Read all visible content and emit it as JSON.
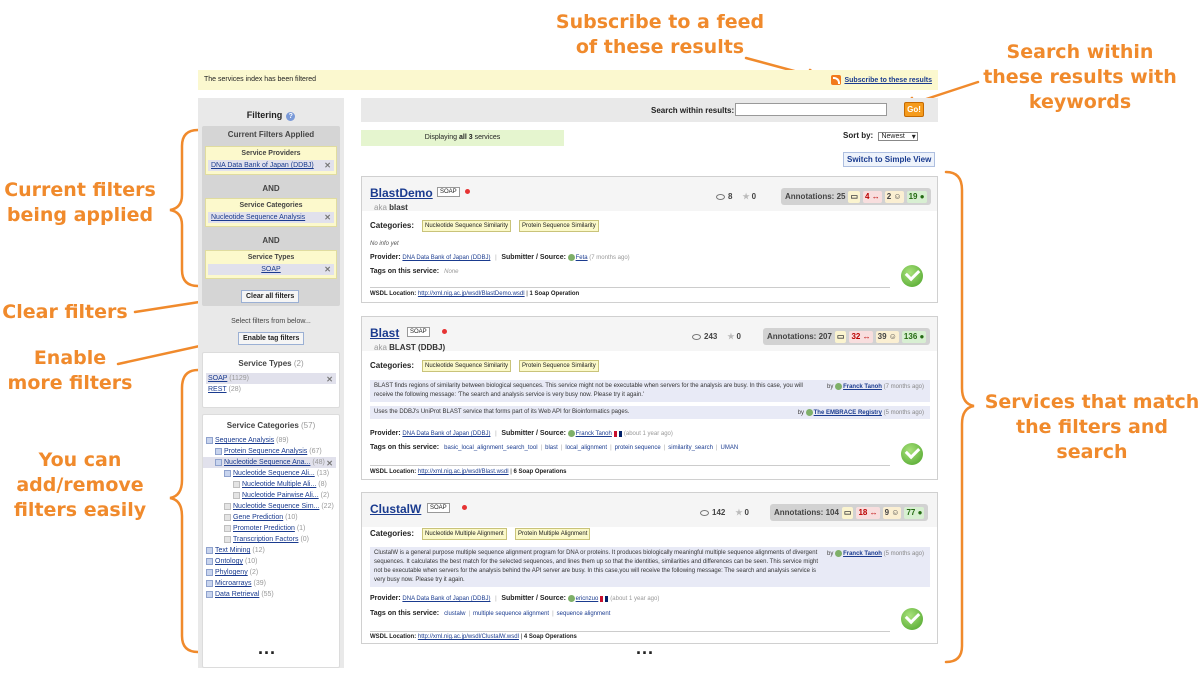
{
  "annotations": {
    "subscribe": "Subscribe to a feed\nof these results",
    "search": "Search within\nthese results with\nkeywords",
    "current_filters": "Current filters\nbeing applied",
    "clear_filters": "Clear filters",
    "enable_more": "Enable\nmore filters",
    "add_remove": "You can\nadd/remove\nfilters easily",
    "services_match": "Services that match\nthe filters and search"
  },
  "topbar": {
    "message": "The services index has been filtered",
    "subscribe_label": "Subscribe to these results"
  },
  "sidebar": {
    "title": "Filtering",
    "current_filters_header": "Current Filters Applied",
    "groups": [
      {
        "header": "Service Providers",
        "value": "DNA Data Bank of Japan (DDBJ)"
      },
      {
        "header": "Service Categories",
        "value": "Nucleotide Sequence Analysis"
      },
      {
        "header": "Service Types",
        "value": "SOAP"
      }
    ],
    "and_label": "AND",
    "clear_all": "Clear all filters",
    "select_text": "Select filters from below...",
    "enable_tags": "Enable tag filters",
    "service_types": {
      "title": "Service Types",
      "count": "(2)",
      "items": [
        {
          "label": "SOAP",
          "count": "(1129)"
        },
        {
          "label": "REST",
          "count": "(28)"
        }
      ]
    },
    "service_categories": {
      "title": "Service Categories",
      "count": "(57)",
      "items": [
        {
          "label": "Sequence Analysis",
          "count": "(89)"
        },
        {
          "label": "Protein Sequence Analysis",
          "count": "(67)"
        },
        {
          "label": "Nucleotide Sequence Ana...",
          "count": "(48)"
        },
        {
          "label": "Nucleotide Sequence Ali...",
          "count": "(13)"
        },
        {
          "label": "Nucleotide Multiple Ali...",
          "count": "(8)"
        },
        {
          "label": "Nucleotide Pairwise Ali...",
          "count": "(2)"
        },
        {
          "label": "Nucleotide Sequence Sim...",
          "count": "(22)"
        },
        {
          "label": "Gene Prediction",
          "count": "(10)"
        },
        {
          "label": "Promoter Prediction",
          "count": "(1)"
        },
        {
          "label": "Transcription Factors",
          "count": "(0)"
        },
        {
          "label": "Text Mining",
          "count": "(12)"
        },
        {
          "label": "Ontology",
          "count": "(10)"
        },
        {
          "label": "Phylogeny",
          "count": "(2)"
        },
        {
          "label": "Microarrays",
          "count": "(39)"
        },
        {
          "label": "Data Retrieval",
          "count": "(55)"
        }
      ]
    }
  },
  "main": {
    "search_label": "Search within results:",
    "search_value": "",
    "go_label": "Go!",
    "displaying_prefix": "Displaying",
    "displaying_count": "all 3",
    "displaying_suffix": "services",
    "sort_label": "Sort by:",
    "sort_value": "Newest",
    "switch_view": "Switch to Simple View",
    "labels": {
      "categories": "Categories:",
      "provider": "Provider:",
      "submitter": "Submitter / Source:",
      "tags": "Tags on this service:",
      "wsdl": "WSDL Location:",
      "annotations": "Annotations:",
      "aka": "aka"
    },
    "services": [
      {
        "name": "BlastDemo",
        "type": "SOAP",
        "aka": "blast",
        "views": "8",
        "favourites": "0",
        "annotations": "25",
        "a1": "",
        "a2": "4",
        "a3": "2",
        "a4": "19",
        "categories": [
          "Nucleotide Sequence Similarity",
          "Protein Sequence Similarity"
        ],
        "info": "No info yet",
        "provider": "DNA Data Bank of Japan (DDBJ)",
        "submitter": "Feta",
        "submitted": "(7 months ago)",
        "tags_none": "None",
        "wsdl": "http://xml.nig.ac.jp/wsdl/BlastDemo.wsdl",
        "operations": "1 Soap Operation"
      },
      {
        "name": "Blast",
        "type": "SOAP",
        "aka": "BLAST (DDBJ)",
        "views": "243",
        "favourites": "0",
        "annotations": "207",
        "a2": "32",
        "a3": "39",
        "a4": "136",
        "categories": [
          "Nucleotide Sequence Similarity",
          "Protein Sequence Similarity"
        ],
        "desc1": "BLAST finds regions of similarity between biological sequences. This service might not be executable when servers for the analysis are busy. In this case, you will receive the following message: 'The search and analysis service is very busy now. Please try it again.'",
        "desc1_by": "Franck Tanoh",
        "desc1_when": "(7 months ago)",
        "desc2": "Uses the DDBJ's UniProt BLAST service that forms part of its Web API for Bioinformatics pages.",
        "desc2_by": "The EMBRACE Registry",
        "desc2_when": "(5 months ago)",
        "provider": "DNA Data Bank of Japan (DDBJ)",
        "submitter": "Franck Tanoh",
        "submitted": "(about 1 year ago)",
        "tags": [
          "basic_local_alignment_search_tool",
          "blast",
          "local_alignment",
          "protein sequence",
          "similarity_search",
          "UMAN"
        ],
        "wsdl": "http://xml.nig.ac.jp/wsdl/Blast.wsdl",
        "operations": "6 Soap Operations"
      },
      {
        "name": "ClustalW",
        "type": "SOAP",
        "views": "142",
        "favourites": "0",
        "annotations": "104",
        "a2": "18",
        "a3": "9",
        "a4": "77",
        "categories": [
          "Nucleotide Multiple Alignment",
          "Protein Multiple Alignment"
        ],
        "desc1": "ClustalW is a general purpose multiple sequence alignment program for DNA or proteins. It produces biologically meaningful multiple sequence alignments of divergent sequences. It calculates the best match for the selected sequences, and lines them up so that the identities, similarities and differences can be seen. This service might not be executable when servers for the analysis behind the API server are busy. In this case,you will receive the following message: The search and analysis service is very busy now. Please try it again.",
        "desc1_by": "Franck Tanoh",
        "desc1_when": "(5 months ago)",
        "provider": "DNA Data Bank of Japan (DDBJ)",
        "submitter": "ericnzuo",
        "submitted": "(about 1 year ago)",
        "tags": [
          "clustalw",
          "multiple sequence alignment",
          "sequence alignment"
        ],
        "wsdl": "http://xml.nig.ac.jp/wsdl/ClustalW.wsdl",
        "operations": "4 Soap Operations"
      }
    ]
  },
  "ellipsis": "...",
  "colors": {
    "annotation": "#f08a2c",
    "link": "#1a3b8f",
    "filter_bg": "#fcf9cc",
    "displaying_bg": "#e5f5cf"
  }
}
